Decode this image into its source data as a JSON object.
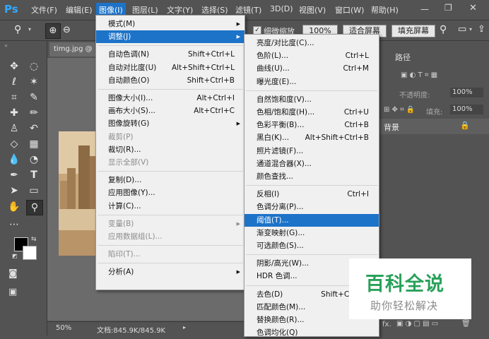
{
  "app": {
    "logo": "Ps"
  },
  "menubar": [
    {
      "label": "文件(F)"
    },
    {
      "label": "编辑(E)"
    },
    {
      "label": "图像(I)"
    },
    {
      "label": "图层(L)"
    },
    {
      "label": "文字(Y)"
    },
    {
      "label": "选择(S)"
    },
    {
      "label": "滤镜(T)"
    },
    {
      "label": "3D(D)"
    },
    {
      "label": "视图(V)"
    },
    {
      "label": "窗口(W)"
    },
    {
      "label": "帮助(H)"
    }
  ],
  "options": {
    "fine_zoom_label": "细微缩放",
    "zoom_value": "100%",
    "fit_screen": "适合屏幕",
    "fill_screen": "填充屏幕"
  },
  "document": {
    "tab_title": "timg.jpg @",
    "zoom": "50%",
    "doc_info": "文档:845.9K/845.9K"
  },
  "right_panel": {
    "paths_tab": "路径",
    "opacity_label": "不透明度:",
    "opacity_value": "100%",
    "fill_label": "填充:",
    "fill_value": "100%",
    "layer_name": "背景"
  },
  "image_menu": {
    "items": [
      {
        "label": "模式(M)",
        "shortcut": "",
        "submenu": true,
        "disabled": false
      },
      {
        "label": "调整(J)",
        "shortcut": "",
        "submenu": true,
        "disabled": false,
        "highlighted": true
      },
      {
        "label": "自动色调(N)",
        "shortcut": "Shift+Ctrl+L",
        "disabled": false
      },
      {
        "label": "自动对比度(U)",
        "shortcut": "Alt+Shift+Ctrl+L",
        "disabled": false
      },
      {
        "label": "自动颜色(O)",
        "shortcut": "Shift+Ctrl+B",
        "disabled": false
      },
      {
        "label": "图像大小(I)...",
        "shortcut": "Alt+Ctrl+I",
        "disabled": false
      },
      {
        "label": "画布大小(S)...",
        "shortcut": "Alt+Ctrl+C",
        "disabled": false
      },
      {
        "label": "图像旋转(G)",
        "shortcut": "",
        "submenu": true,
        "disabled": false
      },
      {
        "label": "裁剪(P)",
        "shortcut": "",
        "disabled": true
      },
      {
        "label": "裁切(R)...",
        "shortcut": "",
        "disabled": false
      },
      {
        "label": "显示全部(V)",
        "shortcut": "",
        "disabled": true
      },
      {
        "label": "复制(D)...",
        "shortcut": "",
        "disabled": false
      },
      {
        "label": "应用图像(Y)...",
        "shortcut": "",
        "disabled": false
      },
      {
        "label": "计算(C)...",
        "shortcut": "",
        "disabled": false
      },
      {
        "label": "变量(B)",
        "shortcut": "",
        "submenu": true,
        "disabled": true
      },
      {
        "label": "应用数据组(L)...",
        "shortcut": "",
        "disabled": true
      },
      {
        "label": "陷印(T)...",
        "shortcut": "",
        "disabled": true
      },
      {
        "label": "分析(A)",
        "shortcut": "",
        "submenu": true,
        "disabled": false
      }
    ]
  },
  "adjust_menu": {
    "items": [
      {
        "label": "亮度/对比度(C)...",
        "shortcut": ""
      },
      {
        "label": "色阶(L)...",
        "shortcut": "Ctrl+L"
      },
      {
        "label": "曲线(U)...",
        "shortcut": "Ctrl+M"
      },
      {
        "label": "曝光度(E)...",
        "shortcut": ""
      },
      {
        "label": "自然饱和度(V)...",
        "shortcut": ""
      },
      {
        "label": "色相/饱和度(H)...",
        "shortcut": "Ctrl+U"
      },
      {
        "label": "色彩平衡(B)...",
        "shortcut": "Ctrl+B"
      },
      {
        "label": "黑白(K)...",
        "shortcut": "Alt+Shift+Ctrl+B"
      },
      {
        "label": "照片滤镜(F)...",
        "shortcut": ""
      },
      {
        "label": "通道混合器(X)...",
        "shortcut": ""
      },
      {
        "label": "颜色查找...",
        "shortcut": ""
      },
      {
        "label": "反相(I)",
        "shortcut": "Ctrl+I"
      },
      {
        "label": "色调分离(P)...",
        "shortcut": ""
      },
      {
        "label": "阈值(T)...",
        "shortcut": "",
        "highlighted": true
      },
      {
        "label": "渐变映射(G)...",
        "shortcut": ""
      },
      {
        "label": "可选颜色(S)...",
        "shortcut": ""
      },
      {
        "label": "阴影/高光(W)...",
        "shortcut": ""
      },
      {
        "label": "HDR 色调...",
        "shortcut": ""
      },
      {
        "label": "去色(D)",
        "shortcut": "Shift+Ctrl+U"
      },
      {
        "label": "匹配颜色(M)...",
        "shortcut": ""
      },
      {
        "label": "替换颜色(R)...",
        "shortcut": ""
      },
      {
        "label": "色调均化(Q)",
        "shortcut": ""
      }
    ]
  },
  "watermark": {
    "title": "百科全说",
    "subtitle": "助你轻松解决"
  },
  "colors": {
    "accent": "#1d73c8",
    "panel": "#535353",
    "menu_bg": "#f0f0f0",
    "logo_blue": "#31a8ff",
    "watermark_green": "#29a15a"
  }
}
